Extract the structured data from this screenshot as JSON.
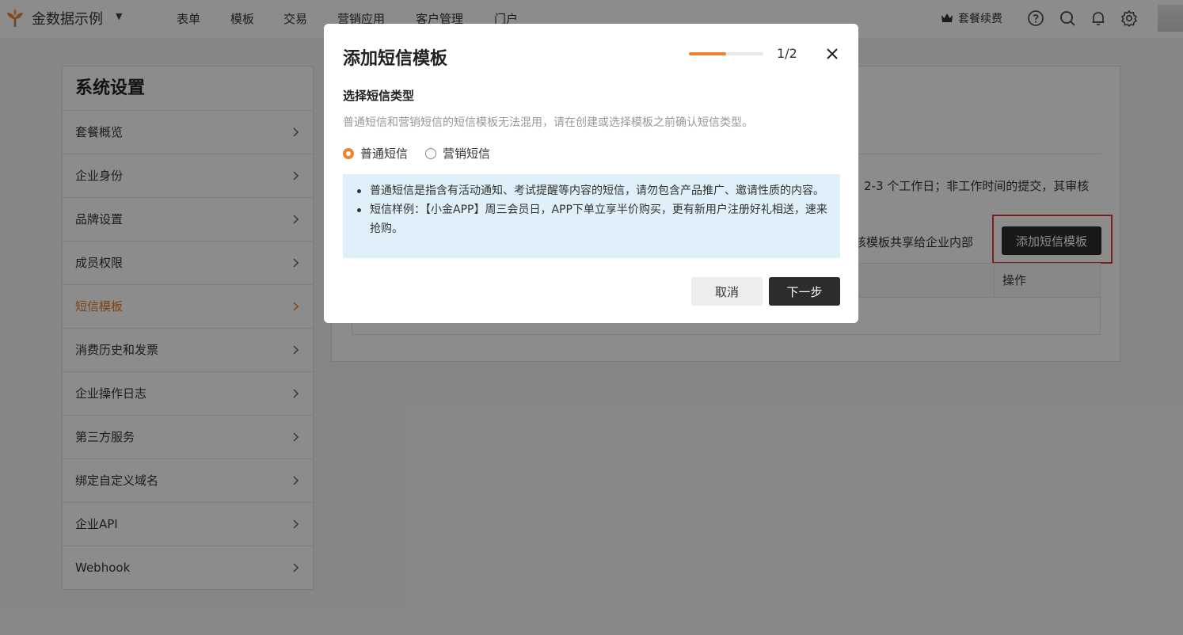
{
  "topnav": {
    "brand": "金数据示例",
    "items": [
      "表单",
      "模板",
      "交易",
      "营销应用",
      "客户管理",
      "门户"
    ],
    "renew": "套餐续费"
  },
  "sidebar": {
    "title": "系统设置",
    "items": [
      {
        "label": "套餐概览"
      },
      {
        "label": "企业身份"
      },
      {
        "label": "品牌设置"
      },
      {
        "label": "成员权限"
      },
      {
        "label": "短信模板"
      },
      {
        "label": "消费历史和发票"
      },
      {
        "label": "企业操作日志"
      },
      {
        "label": "第三方服务"
      },
      {
        "label": "绑定自定义域名"
      },
      {
        "label": "企业API"
      },
      {
        "label": "Webhook"
      }
    ],
    "active_index": 4
  },
  "main": {
    "notice_fragment": "2-3 个工作日；非工作时间的提交，其审核",
    "share_fragment": "核模板共享给企业内部",
    "add_button": "添加短信模板",
    "table_op_header": "操作"
  },
  "modal": {
    "title": "添加短信模板",
    "step": "1/2",
    "progress": 0.5,
    "section_title": "选择短信类型",
    "section_desc": "普通短信和营销短信的短信模板无法混用，请在创建或选择模板之前确认短信类型。",
    "radio_normal": "普通短信",
    "radio_marketing": "营销短信",
    "selected": "普通短信",
    "info": [
      "普通短信是指含有活动通知、考试提醒等内容的短信，请勿包含产品推广、邀请性质的内容。",
      "短信样例：【小金APP】周三会员日，APP下单立享半价购买，更有新用户注册好礼相送，速来抢购。"
    ],
    "cancel": "取消",
    "next": "下一步"
  },
  "colors": {
    "accent": "#f0832f",
    "active_menu": "#e87a24",
    "dark_button": "#2c2c2c",
    "info_bg": "#dff0fb",
    "highlight_box": "#e53935"
  }
}
